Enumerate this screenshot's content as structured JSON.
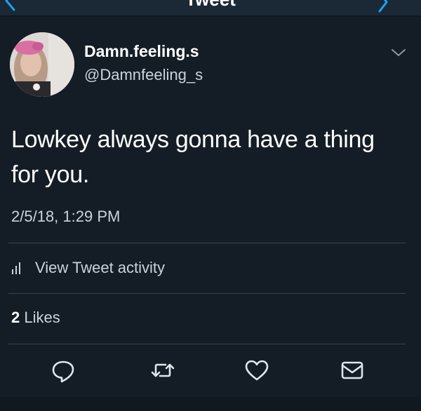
{
  "nav": {
    "title": "Tweet",
    "back_icon": "chevron-left-icon",
    "forward_icon": "chevron-right-icon"
  },
  "author": {
    "display_name": "Damn.feeling.s",
    "handle": "@Damnfeeling_s",
    "avatar": "profile-photo",
    "menu_icon": "chevron-down-icon"
  },
  "tweet": {
    "text": "Lowkey always gonna have a thing for you.",
    "timestamp": "2/5/18, 1:29 PM"
  },
  "activity": {
    "label": "View Tweet activity",
    "icon": "bar-chart-icon"
  },
  "likes": {
    "count": "2",
    "label": "Likes"
  },
  "actions": [
    {
      "name": "reply",
      "icon": "reply-icon"
    },
    {
      "name": "retweet",
      "icon": "retweet-icon"
    },
    {
      "name": "like",
      "icon": "heart-icon"
    },
    {
      "name": "direct-message",
      "icon": "envelope-icon"
    }
  ],
  "colors": {
    "background": "#141d26",
    "topbar": "#1b2836",
    "accent": "#1da1f2",
    "secondary_text": "#c9d3dc",
    "divider": "#36434f"
  }
}
